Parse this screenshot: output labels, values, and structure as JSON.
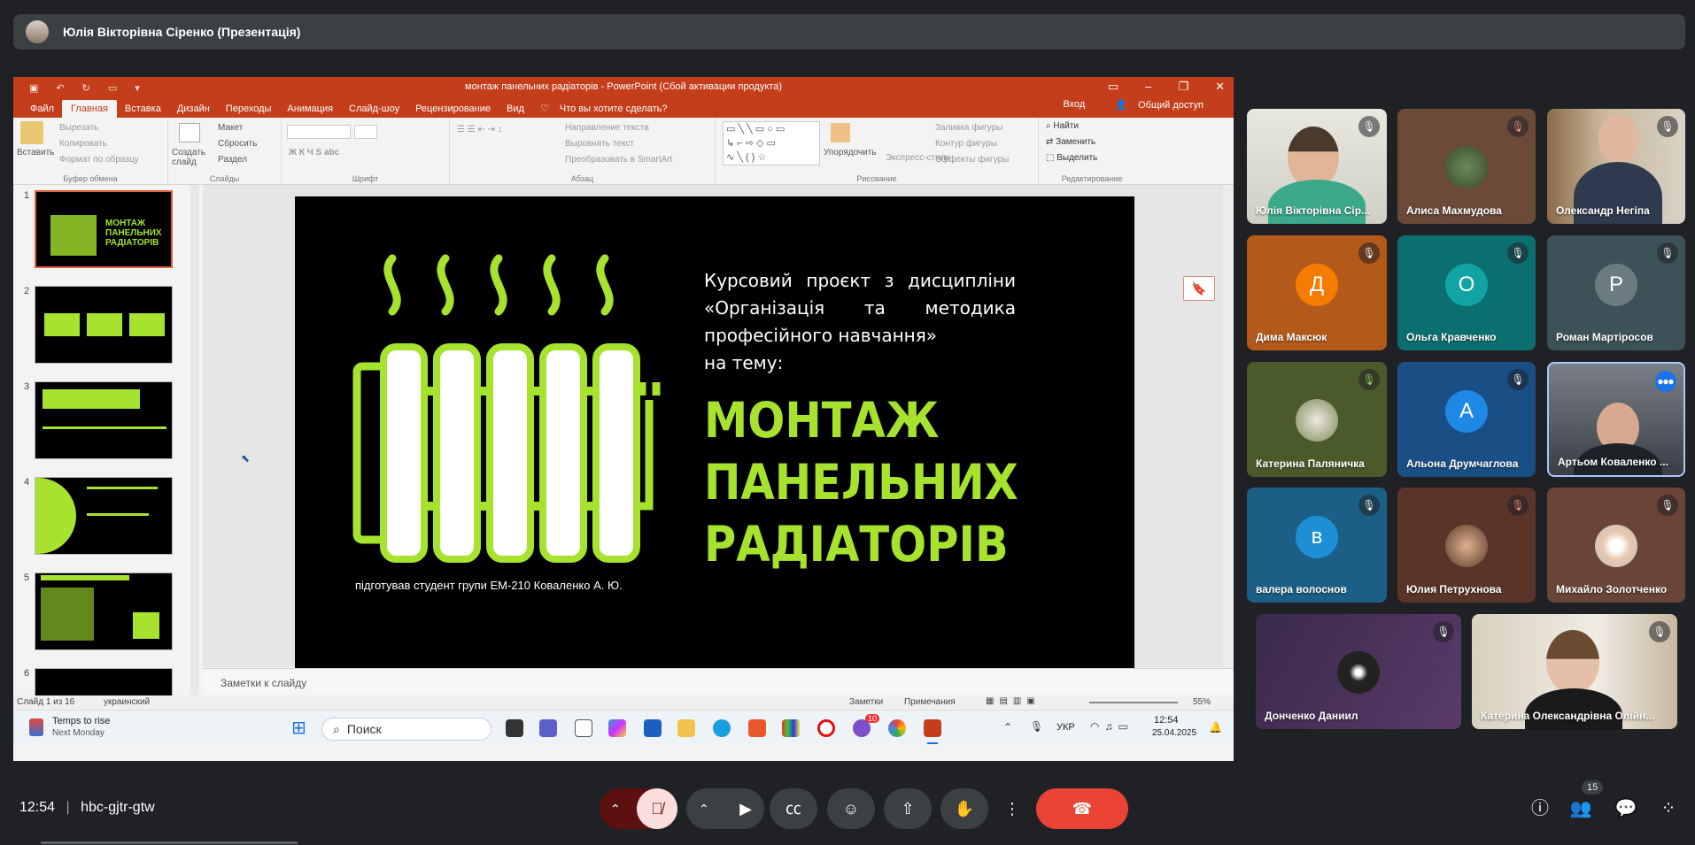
{
  "presenter": {
    "name": "Юлія Вікторівна Сіренко (Презентація)"
  },
  "powerpoint": {
    "title": "монтаж панельних радіаторів - PowerPoint (Сбой активации продукта)",
    "menu": [
      "Файл",
      "Главная",
      "Вставка",
      "Дизайн",
      "Переходы",
      "Анимация",
      "Слайд-шоу",
      "Рецензирование",
      "Вид"
    ],
    "active_tab": "Главная",
    "tell_me": "Что вы хотите сделать?",
    "sign_in": "Вход",
    "share": "Общий доступ",
    "ribbon": {
      "clipboard": {
        "paste": "Вставить",
        "cut": "Вырезать",
        "copy": "Копировать",
        "format": "Формат по образцу",
        "label": "Буфер обмена"
      },
      "slides": {
        "new": "Создать слайд",
        "layout": "Макет",
        "reset": "Сбросить",
        "section": "Раздел",
        "label": "Слайды"
      },
      "font": {
        "label": "Шрифт"
      },
      "paragraph": {
        "dir": "Направление текста",
        "align": "Выровнять текст",
        "smartart": "Преобразовать в SmartArt",
        "label": "Абзац"
      },
      "drawing": {
        "arrange": "Упорядочить",
        "styles": "Экспресс-стили",
        "fill": "Заливка фигуры",
        "outline": "Контур фигуры",
        "effects": "Эффекты фигуры",
        "label": "Рисование"
      },
      "editing": {
        "find": "Найти",
        "replace": "Заменить",
        "select": "Выделить",
        "label": "Редактирование"
      }
    },
    "slide_numbers": [
      "1",
      "2",
      "3",
      "4",
      "5",
      "6"
    ],
    "slide": {
      "subtitle_lines": [
        "Курсовий проєкт з дисципліни",
        "«Організація та методика",
        "професійного навчання»",
        "на тему:"
      ],
      "title_lines": [
        "МОНТАЖ",
        "ПАНЕЛЬНИХ",
        "РАДІАТОРІВ"
      ],
      "author": "підготував студент групи ЕМ-210 Коваленко А. Ю."
    },
    "notes_placeholder": "Заметки к слайду",
    "status": {
      "slide": "Слайд 1 из 16",
      "lang": "украинский",
      "notes": "Заметки",
      "comments": "Примечания",
      "zoom": "55%"
    },
    "accent": "#c43e1c",
    "slide_green": "#a6e22e"
  },
  "taskbar": {
    "weather_title": "Temps to rise",
    "weather_sub": "Next Monday",
    "search": "Поиск",
    "lang": "УКР",
    "time": "12:54",
    "date": "25.04.2025",
    "badge": "10"
  },
  "participants": [
    {
      "name": "Юлія Вікторівна Сір...",
      "kind": "video"
    },
    {
      "name": "Алиса Махмудова",
      "kind": "photo"
    },
    {
      "name": "Олександр Негіпа",
      "kind": "video"
    },
    {
      "name": "Дима Максюк",
      "initial": "Д"
    },
    {
      "name": "Ольга Кравченко",
      "initial": "О"
    },
    {
      "name": "Роман Мартіросов",
      "initial": "Р"
    },
    {
      "name": "Катерина Паляничка",
      "kind": "photo"
    },
    {
      "name": "Альона Друмчаглова",
      "initial": "А"
    },
    {
      "name": "Артьом Коваленко ...",
      "kind": "video"
    },
    {
      "name": "валера волоснов",
      "initial": "в"
    },
    {
      "name": "Юлия Петрухнова",
      "kind": "photo"
    },
    {
      "name": "Михайло Золотченко",
      "kind": "photo"
    },
    {
      "name": "Донченко Даниил",
      "kind": "photo"
    },
    {
      "name": "Катерина Олександрівна Олійн...",
      "kind": "video"
    }
  ],
  "meeting": {
    "time": "12:54",
    "separator": "|",
    "code": "hbc-gjtr-gtw",
    "people_count": "15"
  },
  "icons": [
    "mic-off-icon",
    "camera-icon",
    "captions-icon",
    "emoji-icon",
    "present-icon",
    "raise-hand-icon",
    "more-icon",
    "end-call-icon",
    "info-icon",
    "people-icon",
    "chat-icon",
    "activities-icon"
  ]
}
